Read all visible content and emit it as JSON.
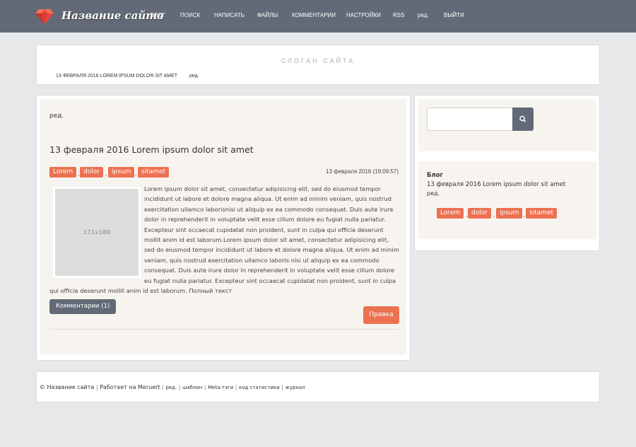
{
  "nav": {
    "site_name": "Название сайта",
    "items": [
      "БЛОГ",
      "ПОИСК",
      "НАПИСАТЬ",
      "ФАЙЛЫ",
      "КОММЕНТАРИИ",
      "НАСТРОЙКИ",
      "RSS",
      "ред.",
      "ВЫЙТИ"
    ]
  },
  "header": {
    "slogan": "СЛОГАН САЙТА",
    "post_link": "13 февраля 2016 Lorem ipsum dolor sit amet",
    "edit_link": "ред."
  },
  "post": {
    "edit_top": "ред.",
    "title": "13 февраля 2016 Lorem ipsum dolor sit amet",
    "tags": [
      "Lorem",
      "dolor",
      "ipsum",
      "sitamet"
    ],
    "date": "13 февраля 2016 (19:09:57)",
    "thumbnail_label": "171x180",
    "body": "Lorem ipsum dolor sit amet, consectetur adipisicing elit, sed do eiusmod tempor incididunt ut labore et dolore magna aliqua. Ut enim ad minim veniam, quis nostrud exercitation ullamco laborisnisi ut aliquip ex ea commodo consequat. Duis aute irure dolor in reprehenderit in voluptate velit esse cillum dolore eu fugiat nulla pariatur. Excepteur sint occaecat cupidatat non proident, sunt in culpa qui officia deserunt mollit anim id est laborum.Lorem ipsum dolor sit amet, consectetur adipisicing elit, sed do eiusmod tempor incididunt ut labore et dolore magna aliqua. Ut enim ad minim veniam, quis nostrud exercitation ullamco laboris nisi ut aliquip ex ea commodo consequat. Duis aute irure dolor in reprehenderit in voluptate velit esse cillum dolore eu fugiat nulla pariatur. Excepteur sint occaecat cupidatat non proident, sunt in culpa qui officia deserunt mollit anim id est laborum.",
    "full_text_link": "Полный текст",
    "comments_button": "Комментарии (1)",
    "edit_button": "Правка"
  },
  "sidebar": {
    "search_placeholder": "",
    "heading": "Блог",
    "link": "13 февраля 2016 Lorem ipsum dolor sit amet",
    "edit": "ред.",
    "tags": [
      "Lorem",
      "dolor",
      "ipsum",
      "sitamet"
    ]
  },
  "footer": {
    "copyright": "© Название сайта",
    "powered": "Работает на Meruert",
    "edit": "ред.",
    "template": "шаблон",
    "meta": "Meta-тэги",
    "stats": "код статистики",
    "journal": "журнал"
  },
  "colors": {
    "navbar": "#636a77",
    "accent": "#ec7152",
    "panel_inner": "#f7f4ef",
    "background": "#e7e8ea"
  }
}
